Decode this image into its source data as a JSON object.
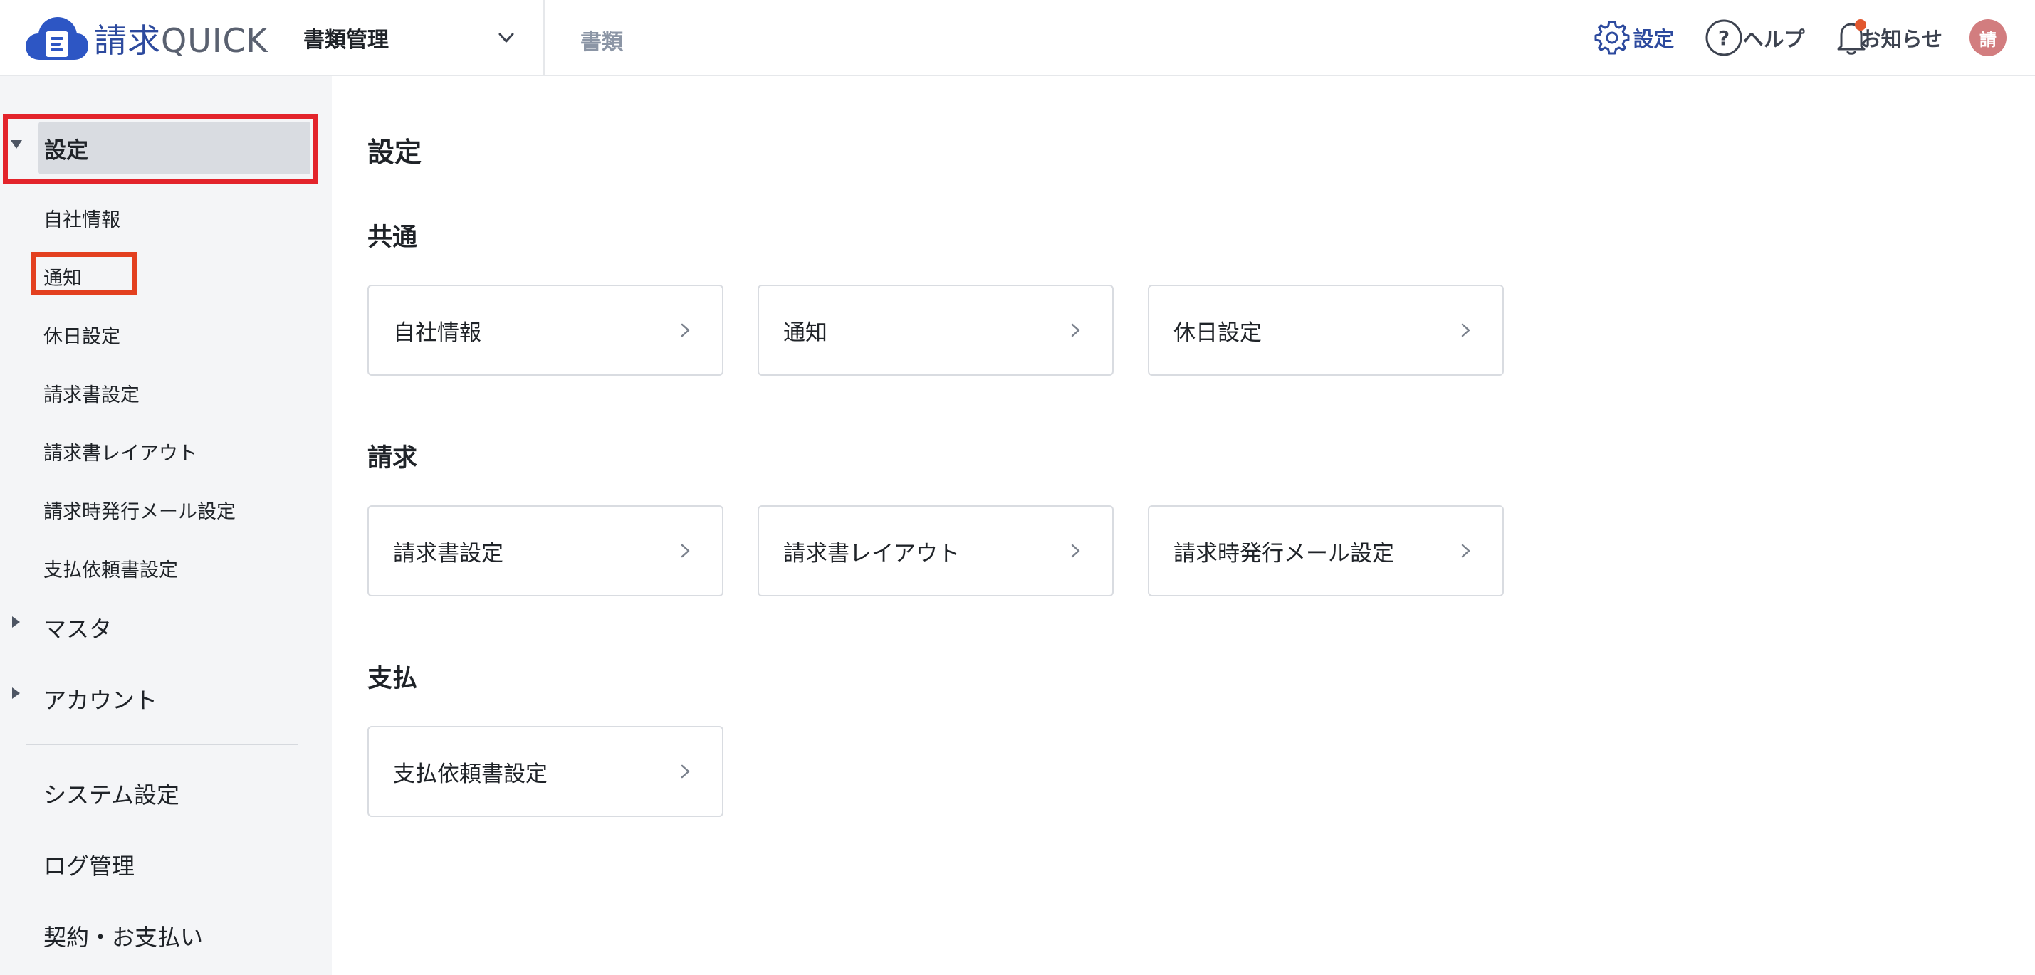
{
  "header": {
    "logo_text": "請求",
    "logo_text_latin": "QUICK",
    "doc_select_label": "書類管理",
    "nav_docs_label": "書類",
    "settings_label": "設定",
    "help_label": "ヘルプ",
    "notice_label": "お知らせ",
    "avatar_initial": "請",
    "accent_color": "#2d4a9e",
    "notification_dot_color": "#e2582f"
  },
  "sidebar": {
    "settings_label": "設定",
    "settings_items": [
      {
        "label": "自社情報"
      },
      {
        "label": "通知"
      },
      {
        "label": "休日設定"
      },
      {
        "label": "請求書設定"
      },
      {
        "label": "請求書レイアウト"
      },
      {
        "label": "請求時発行メール設定"
      },
      {
        "label": "支払依頼書設定"
      }
    ],
    "master_label": "マスタ",
    "account_label": "アカウント",
    "system_settings_label": "システム設定",
    "log_label": "ログ管理",
    "contract_label": "契約・お支払い"
  },
  "main": {
    "title": "設定",
    "sections": [
      {
        "title": "共通",
        "cards": [
          {
            "label": "自社情報"
          },
          {
            "label": "通知"
          },
          {
            "label": "休日設定"
          }
        ]
      },
      {
        "title": "請求",
        "cards": [
          {
            "label": "請求書設定"
          },
          {
            "label": "請求書レイアウト"
          },
          {
            "label": "請求時発行メール設定"
          }
        ]
      },
      {
        "title": "支払",
        "cards": [
          {
            "label": "支払依頼書設定"
          }
        ]
      }
    ]
  }
}
